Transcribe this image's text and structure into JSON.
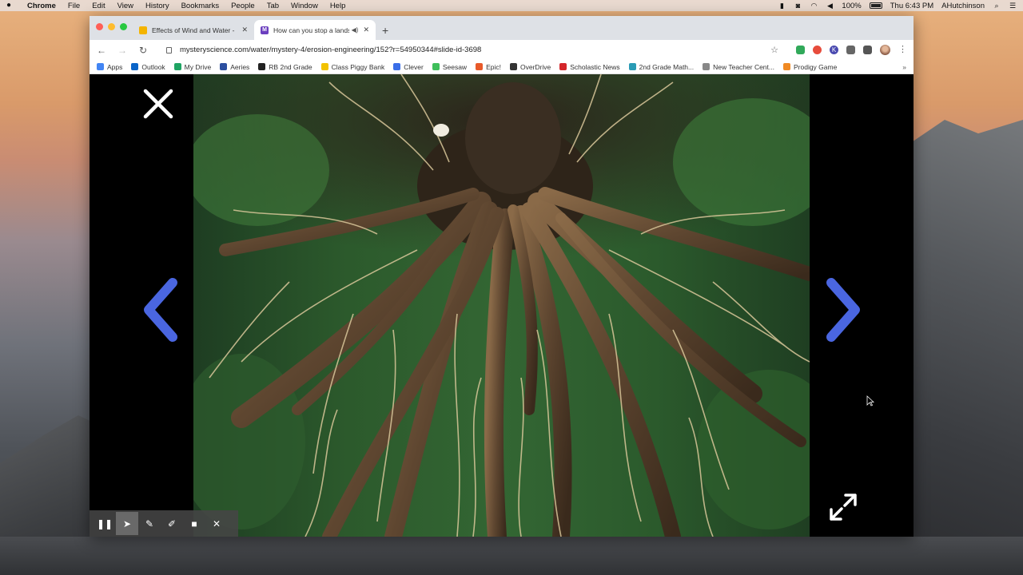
{
  "menubar": {
    "app": "Chrome",
    "items": [
      "File",
      "Edit",
      "View",
      "History",
      "Bookmarks",
      "People",
      "Tab",
      "Window",
      "Help"
    ],
    "battery": "100%",
    "clock": "Thu 6:43 PM",
    "user": "AHutchinson"
  },
  "tabs": [
    {
      "title": "Effects of Wind and Water - G",
      "favicon": "google-slides-icon"
    },
    {
      "title": "How can you stop a landsl",
      "favicon": "mystery-science-icon",
      "active": true
    }
  ],
  "address": {
    "url": "mysteryscience.com/water/mystery-4/erosion-engineering/152?r=54950344#slide-id-3698"
  },
  "bookmarks": [
    {
      "label": "Apps",
      "color": "#4285f4"
    },
    {
      "label": "Outlook",
      "color": "#0a64c8"
    },
    {
      "label": "My Drive",
      "color": "#1fa463"
    },
    {
      "label": "Aeries",
      "color": "#2c4fa0"
    },
    {
      "label": "RB 2nd Grade",
      "color": "#222222"
    },
    {
      "label": "Class Piggy Bank",
      "color": "#f2c200"
    },
    {
      "label": "Clever",
      "color": "#3a6ee8"
    },
    {
      "label": "Seesaw",
      "color": "#3fbf5b"
    },
    {
      "label": "Epic!",
      "color": "#e85a2a"
    },
    {
      "label": "OverDrive",
      "color": "#333333"
    },
    {
      "label": "Scholastic News",
      "color": "#d4262b"
    },
    {
      "label": "2nd Grade Math...",
      "color": "#2a9bb5"
    },
    {
      "label": "New Teacher Cent...",
      "color": "#888888"
    },
    {
      "label": "Prodigy Game",
      "color": "#f08a24"
    }
  ],
  "bookmarks_more": "»",
  "slide": {
    "arrow_color": "#4a66e0"
  },
  "annotation_tools": [
    {
      "name": "pause-icon",
      "glyph": "❚❚"
    },
    {
      "name": "pointer-icon",
      "glyph": "➤",
      "selected": true
    },
    {
      "name": "pen-icon",
      "glyph": "✎"
    },
    {
      "name": "highlighter-icon",
      "glyph": "✐"
    },
    {
      "name": "camera-icon",
      "glyph": "■"
    },
    {
      "name": "close-icon",
      "glyph": "✕"
    }
  ]
}
